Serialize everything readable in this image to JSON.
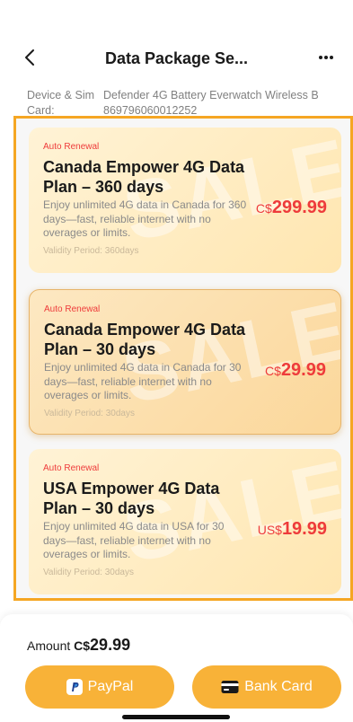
{
  "header": {
    "title": "Data Package Se...",
    "back_icon": "chevron-left-icon",
    "more_icon": "more-horizontal-icon"
  },
  "device": {
    "label_line1": "Device & Sim",
    "label_line2": "Card:",
    "name": "Defender 4G Battery Everwatch Wireless B",
    "sim": "869796060012252"
  },
  "plans": [
    {
      "badge": "Auto Renewal",
      "name": "Canada Empower 4G Data Plan – 360 days",
      "description": "Enjoy unlimited 4G data in Canada for 360 days—fast, reliable internet with no overages or limits.",
      "validity": "Validity Period: 360days",
      "currency": "C$",
      "price": "299.99",
      "selected": false
    },
    {
      "badge": "Auto Renewal",
      "name": "Canada Empower 4G Data Plan – 30 days",
      "description": "Enjoy unlimited 4G data in Canada for 30 days—fast, reliable internet with no overages or limits.",
      "validity": "Validity Period: 30days",
      "currency": "C$",
      "price": "29.99",
      "selected": true
    },
    {
      "badge": "Auto Renewal",
      "name": "USA Empower 4G Data Plan – 30 days",
      "description": "Enjoy unlimited 4G data in USA for 30 days—fast, reliable internet with no overages or limits.",
      "validity": "Validity Period: 30days",
      "currency": "US$",
      "price": "19.99",
      "selected": false
    }
  ],
  "watermark": "SALE",
  "footer": {
    "amount_label": "Amount",
    "amount_currency": "C$",
    "amount_value": "29.99",
    "paypal_label": "PayPal",
    "bank_label": "Bank Card"
  },
  "colors": {
    "accent": "#f8b238",
    "price": "#ee3b3b",
    "frame": "#f5a623"
  }
}
